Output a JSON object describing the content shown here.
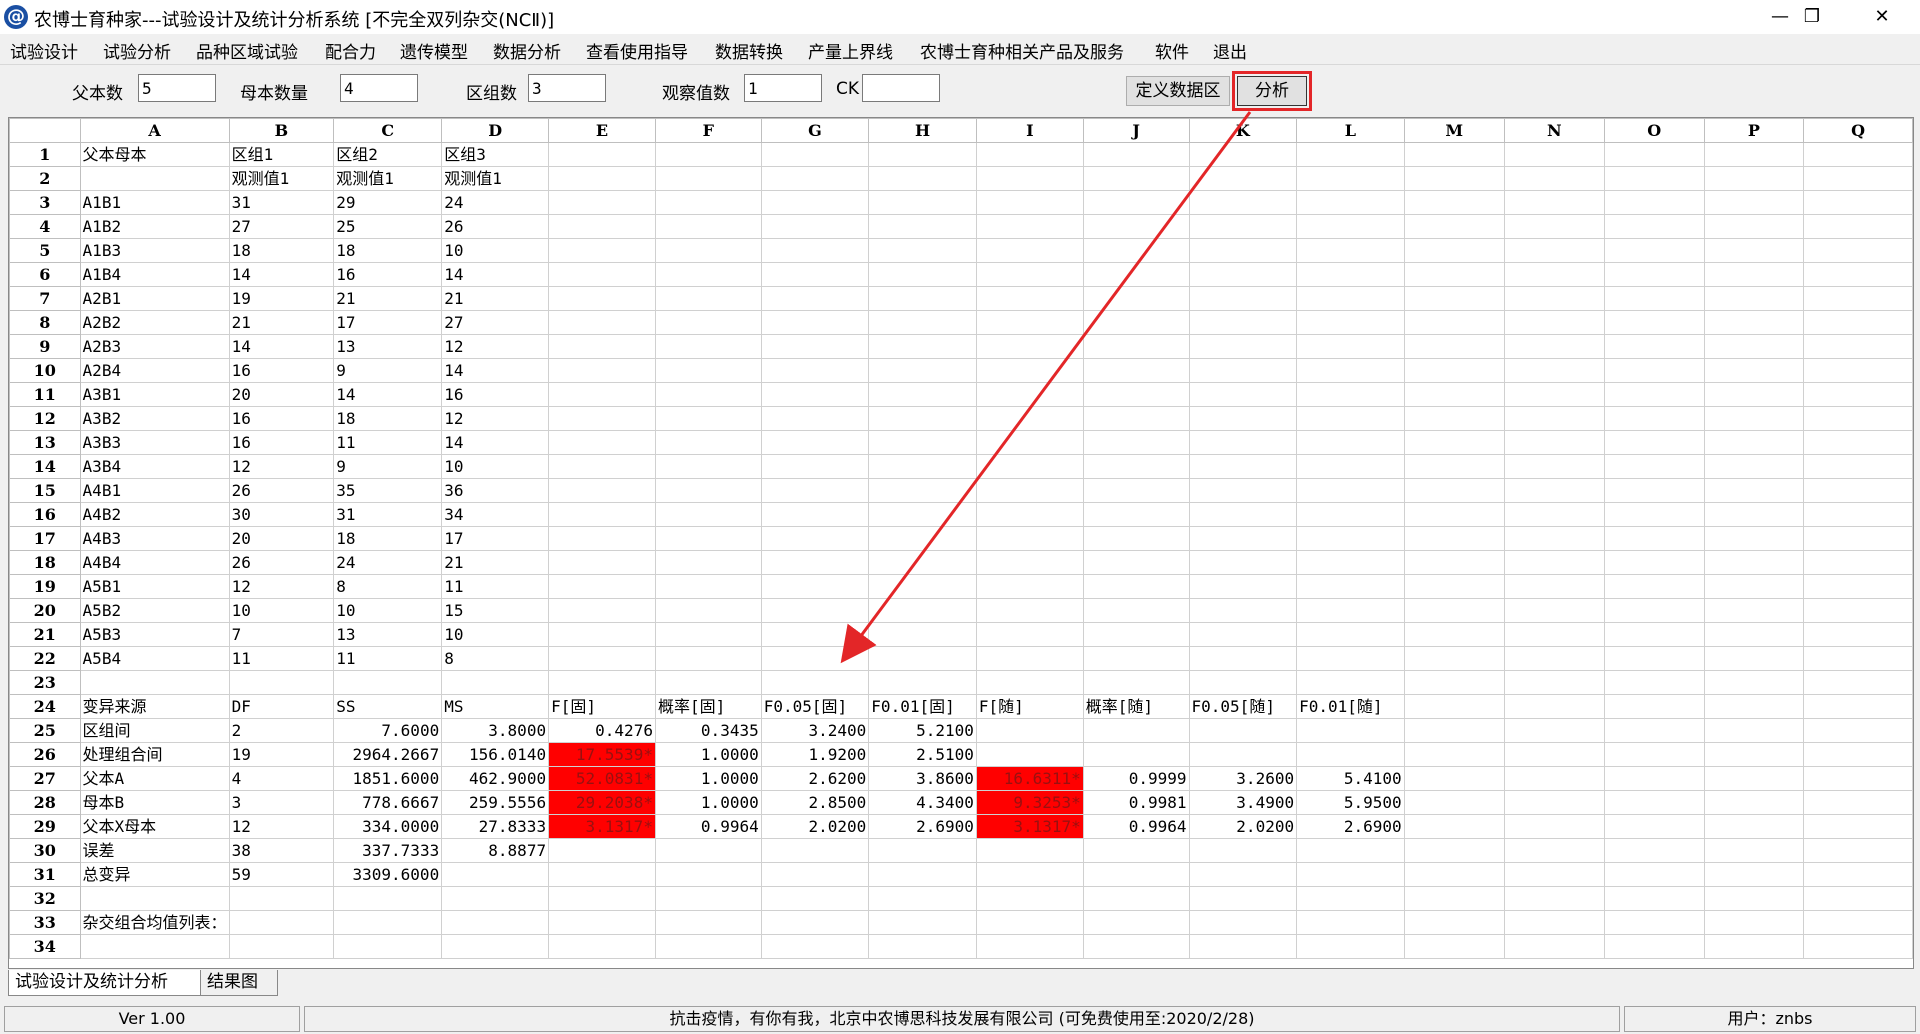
{
  "window": {
    "icon": "@",
    "title": "农博士育种家---试验设计及统计分析系统 [不完全双列杂交(NCⅡ)]",
    "minimize": "—",
    "maximize": "❐",
    "close": "✕"
  },
  "menu": [
    "试验设计",
    "试验分析",
    "品种区域试验",
    "配合力",
    "遗传模型",
    "数据分析",
    "查看使用指导",
    "数据转换",
    "产量上界线",
    "农博士育种相关产品及服务",
    "软件",
    "退出"
  ],
  "toolbar": {
    "father_label": "父本数",
    "father_value": "5",
    "mother_label": "母本数量",
    "mother_value": "4",
    "block_label": "区组数",
    "block_value": "3",
    "obs_label": "观察值数",
    "obs_value": "1",
    "ck_label": "CK",
    "ck_value": "",
    "define_button": "定义数据区",
    "analyze_button": "分析"
  },
  "grid": {
    "columns": [
      "A",
      "B",
      "C",
      "D",
      "E",
      "F",
      "G",
      "H",
      "I",
      "J",
      "K",
      "L",
      "M",
      "N",
      "O",
      "P",
      "Q"
    ],
    "rows": [
      {
        "n": "1",
        "cells": [
          "父本母本",
          "区组1",
          "区组2",
          "区组3"
        ]
      },
      {
        "n": "2",
        "cells": [
          "",
          "观测值1",
          "观测值1",
          "观测值1"
        ]
      },
      {
        "n": "3",
        "cells": [
          "A1B1",
          "31",
          "29",
          "24"
        ]
      },
      {
        "n": "4",
        "cells": [
          "A1B2",
          "27",
          "25",
          "26"
        ]
      },
      {
        "n": "5",
        "cells": [
          "A1B3",
          "18",
          "18",
          "10"
        ]
      },
      {
        "n": "6",
        "cells": [
          "A1B4",
          "14",
          "16",
          "14"
        ]
      },
      {
        "n": "7",
        "cells": [
          "A2B1",
          "19",
          "21",
          "21"
        ]
      },
      {
        "n": "8",
        "cells": [
          "A2B2",
          "21",
          "17",
          "27"
        ]
      },
      {
        "n": "9",
        "cells": [
          "A2B3",
          "14",
          "13",
          "12"
        ]
      },
      {
        "n": "10",
        "cells": [
          "A2B4",
          "16",
          "9",
          "14"
        ]
      },
      {
        "n": "11",
        "cells": [
          "A3B1",
          "20",
          "14",
          "16"
        ]
      },
      {
        "n": "12",
        "cells": [
          "A3B2",
          "16",
          "18",
          "12"
        ]
      },
      {
        "n": "13",
        "cells": [
          "A3B3",
          "16",
          "11",
          "14"
        ]
      },
      {
        "n": "14",
        "cells": [
          "A3B4",
          "12",
          "9",
          "10"
        ]
      },
      {
        "n": "15",
        "cells": [
          "A4B1",
          "26",
          "35",
          "36"
        ]
      },
      {
        "n": "16",
        "cells": [
          "A4B2",
          "30",
          "31",
          "34"
        ]
      },
      {
        "n": "17",
        "cells": [
          "A4B3",
          "20",
          "18",
          "17"
        ]
      },
      {
        "n": "18",
        "cells": [
          "A4B4",
          "26",
          "24",
          "21"
        ]
      },
      {
        "n": "19",
        "cells": [
          "A5B1",
          "12",
          "8",
          "11"
        ]
      },
      {
        "n": "20",
        "cells": [
          "A5B2",
          "10",
          "10",
          "15"
        ]
      },
      {
        "n": "21",
        "cells": [
          "A5B3",
          "7",
          "13",
          "10"
        ]
      },
      {
        "n": "22",
        "cells": [
          "A5B4",
          "11",
          "11",
          "8"
        ]
      },
      {
        "n": "23",
        "cells": []
      },
      {
        "n": "24",
        "cells": [
          "变异来源",
          "DF",
          "SS",
          "MS",
          "F[固]",
          "概率[固]",
          "F0.05[固]",
          "F0.01[固]",
          "F[随]",
          "概率[随]",
          "F0.05[随]",
          "F0.01[随]"
        ]
      },
      {
        "n": "25",
        "cells": [
          "区组间",
          "2",
          "7.6000",
          "3.8000",
          "0.4276",
          "0.3435",
          "3.2400",
          "5.2100"
        ]
      },
      {
        "n": "26",
        "cells": [
          "处理组合间",
          "19",
          "2964.2667",
          "156.0140",
          "17.5539*",
          "1.0000",
          "1.9200",
          "2.5100"
        ]
      },
      {
        "n": "27",
        "cells": [
          "父本A",
          "4",
          "1851.6000",
          "462.9000",
          "52.0831*",
          "1.0000",
          "2.6200",
          "3.8600",
          "16.6311*",
          "0.9999",
          "3.2600",
          "5.4100"
        ]
      },
      {
        "n": "28",
        "cells": [
          "母本B",
          "3",
          "778.6667",
          "259.5556",
          "29.2038*",
          "1.0000",
          "2.8500",
          "4.3400",
          "9.3253*",
          "0.9981",
          "3.4900",
          "5.9500"
        ]
      },
      {
        "n": "29",
        "cells": [
          "父本X母本",
          "12",
          "334.0000",
          "27.8333",
          "3.1317*",
          "0.9964",
          "2.0200",
          "2.6900",
          "3.1317*",
          "0.9964",
          "2.0200",
          "2.6900"
        ]
      },
      {
        "n": "30",
        "cells": [
          "误差",
          "38",
          "337.7333",
          "8.8877"
        ]
      },
      {
        "n": "31",
        "cells": [
          "总变异",
          "59",
          "3309.6000"
        ]
      },
      {
        "n": "32",
        "cells": []
      },
      {
        "n": "33",
        "cells": [
          "杂交组合均值列表："
        ]
      },
      {
        "n": "34",
        "cells": []
      }
    ]
  },
  "tabs": [
    "试验设计及统计分析",
    "结果图"
  ],
  "status": {
    "version": "Ver 1.00",
    "message": "抗击疫情，有你有我，北京中农博思科技发展有限公司 (可免费使用至:2020/2/28)",
    "user": "用户：znbs"
  },
  "colors": {
    "highlight": "#ff0000",
    "annotation": "#e32628"
  }
}
